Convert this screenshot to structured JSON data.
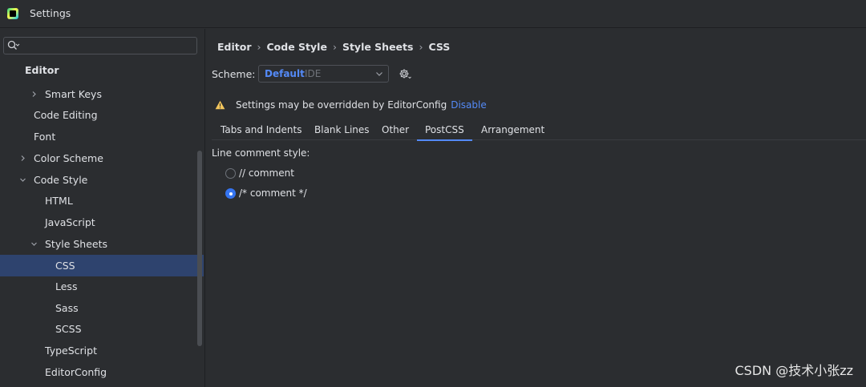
{
  "window": {
    "title": "Settings"
  },
  "search": {
    "placeholder": "",
    "value": ""
  },
  "sidebar": {
    "items": [
      {
        "label": "Editor"
      },
      {
        "label": "Smart Keys"
      },
      {
        "label": "Code Editing"
      },
      {
        "label": "Font"
      },
      {
        "label": "Color Scheme"
      },
      {
        "label": "Code Style"
      },
      {
        "label": "HTML"
      },
      {
        "label": "JavaScript"
      },
      {
        "label": "Style Sheets"
      },
      {
        "label": "CSS"
      },
      {
        "label": "Less"
      },
      {
        "label": "Sass"
      },
      {
        "label": "SCSS"
      },
      {
        "label": "TypeScript"
      },
      {
        "label": "EditorConfig"
      }
    ],
    "selected": "CSS"
  },
  "breadcrumb": [
    "Editor",
    "Code Style",
    "Style Sheets",
    "CSS"
  ],
  "scheme": {
    "label": "Scheme:",
    "selected_name": "Default",
    "selected_kind": "IDE"
  },
  "notice": {
    "text": "Settings may be overridden by EditorConfig",
    "link": "Disable"
  },
  "tabs": [
    {
      "label": "Tabs and Indents"
    },
    {
      "label": "Blank Lines"
    },
    {
      "label": "Other"
    },
    {
      "label": "PostCSS"
    },
    {
      "label": "Arrangement"
    }
  ],
  "active_tab": "PostCSS",
  "line_comment": {
    "label": "Line comment style:",
    "options": [
      {
        "label": "// comment",
        "checked": false
      },
      {
        "label": "/* comment */",
        "checked": true
      }
    ]
  },
  "watermark": "CSDN @技术小张zz",
  "colors": {
    "background": "#2b2d30",
    "selection": "#2e436e",
    "accent": "#548af7",
    "warning": "#f2c55c"
  }
}
